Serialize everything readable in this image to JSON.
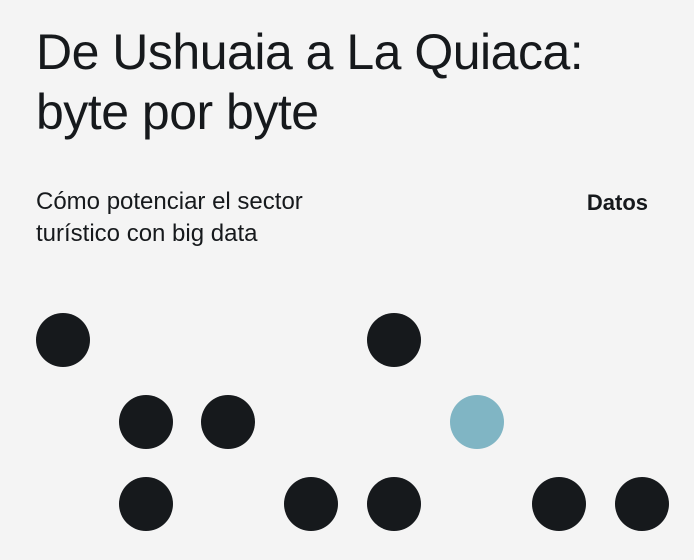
{
  "card": {
    "title_lines": [
      "De Ushuaia a La Quiaca:",
      "byte por byte"
    ],
    "subtitle_lines": [
      "Cómo potenciar el sector",
      "turístico con big data"
    ],
    "category": "Datos"
  },
  "colors": {
    "background": "#f4f4f4",
    "text": "#16191c",
    "dot_dark": "#16191c",
    "dot_accent": "#80b5c4"
  },
  "dot_pattern": {
    "rows": [
      [
        1,
        0,
        0,
        0,
        1,
        0,
        0,
        0
      ],
      [
        0,
        1,
        1,
        0,
        0,
        2,
        0,
        0
      ],
      [
        0,
        1,
        0,
        1,
        1,
        0,
        1,
        1
      ]
    ]
  }
}
